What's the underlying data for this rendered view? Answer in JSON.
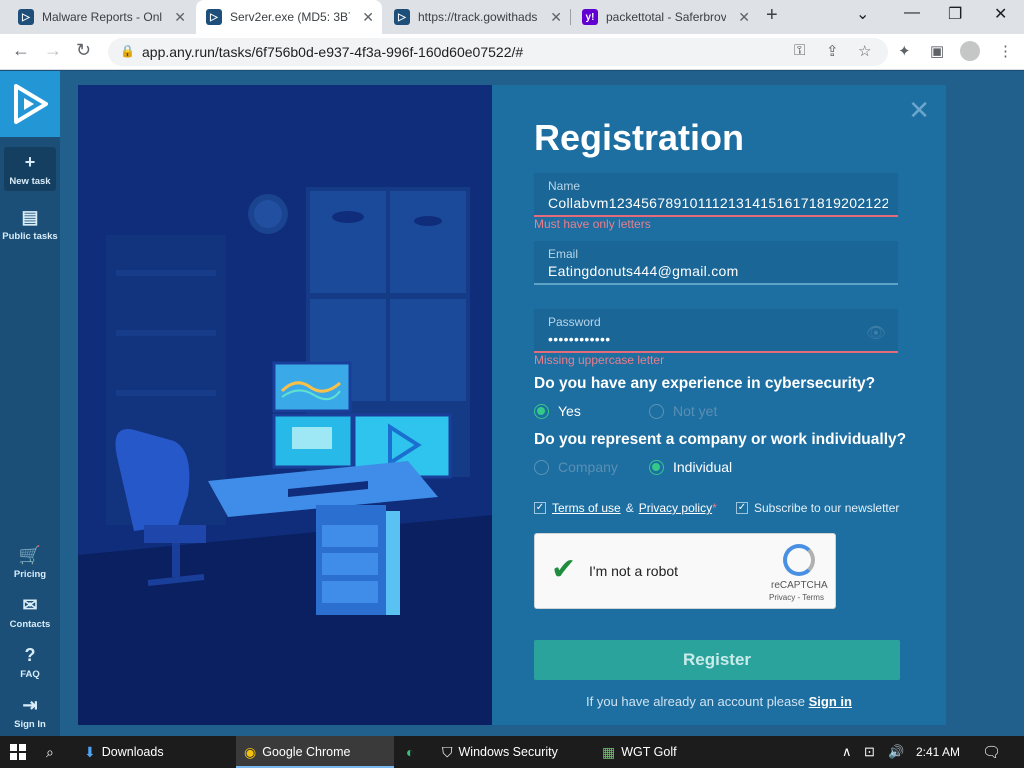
{
  "browser": {
    "tabs": [
      {
        "title": "Malware Reports - Onl",
        "favicon_color": "#1d4f7a"
      },
      {
        "title": "Serv2er.exe (MD5: 3B7",
        "favicon_color": "#1d4f7a"
      },
      {
        "title": "https://track.gowithads",
        "favicon_color": "#1d4f7a"
      },
      {
        "title": "packettotal - Saferbrov",
        "favicon_color": "#6001d2"
      }
    ],
    "yahoo_favicon_text": "y!",
    "url": "app.any.run/tasks/6f756b0d-e937-4f3a-996f-160d60e07522/#"
  },
  "sidebar": {
    "new_task": "New task",
    "public_tasks": "Public tasks",
    "pricing": "Pricing",
    "contacts": "Contacts",
    "faq": "FAQ",
    "sign_in": "Sign In"
  },
  "registration": {
    "title": "Registration",
    "name_label": "Name",
    "name_value": "Collabvm12345678910111213141516171819202122",
    "name_error": "Must have only letters",
    "email_label": "Email",
    "email_value": "Eatingdonuts444@gmail.com",
    "password_label": "Password",
    "password_value": "••••••••••••",
    "password_error": "Missing uppercase letter",
    "q_experience": "Do you have any experience in cybersecurity?",
    "opt_yes": "Yes",
    "opt_not_yet": "Not yet",
    "q_company": "Do you represent a company or work individually?",
    "opt_company": "Company",
    "opt_individual": "Individual",
    "terms": "Terms of use",
    "amp": "&",
    "privacy": "Privacy policy",
    "asterisk": "*",
    "newsletter": "Subscribe to our newsletter",
    "captcha_label": "I'm not a robot",
    "captcha_brand": "reCAPTCHA",
    "captcha_links": "Privacy - Terms",
    "register": "Register",
    "signin_prompt": "If you have already an account please",
    "signin_link": "Sign in"
  },
  "taskbar": {
    "downloads": "Downloads",
    "chrome": "Google Chrome",
    "windows_security": "Windows Security",
    "wgt_golf": "WGT Golf",
    "time": "2:41 AM"
  }
}
